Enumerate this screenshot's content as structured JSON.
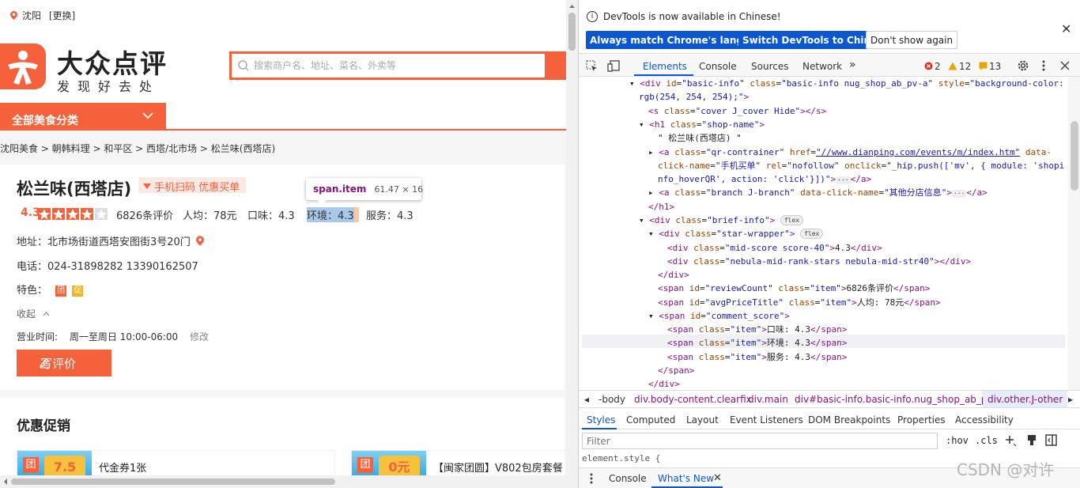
{
  "page": {
    "city": "沈阳",
    "switch_city": "[更换]",
    "logo_main": "大众点评",
    "logo_sub": "发现好去处",
    "search_placeholder": "搜索商户名、地址、菜名、外卖等",
    "category_button": "全部美食分类",
    "breadcrumb": "沈阳美食 > 朝韩料理 > 和平区 > 西塔/北市场 > 松兰味(西塔店)",
    "shop_name": "松兰味(西塔店)",
    "qr_label": "手机扫码 优惠买单",
    "tooltip_name": "span.item",
    "tooltip_size": "61.47 × 16",
    "score": "4.3",
    "star_rating": 4,
    "star_max": 5,
    "review_count": "6826条评价",
    "avg_price": "人均：78元",
    "taste": "口味：4.3",
    "environment": "环境：4.3",
    "service": "服务：4.3",
    "address": "地址：北市场街道西塔安图街3号20门",
    "phone": "电话：024-31898282 13390162507",
    "features_label": "特色：",
    "feature_tags": [
      "团",
      "促"
    ],
    "collapse": "收起",
    "hours_label": "营业时间:",
    "hours_value": "周一至周日 10:00-06:00",
    "hours_edit": "修改",
    "review_button": "写评价",
    "promo_title": "优惠促销",
    "promos": [
      {
        "badge": "团",
        "image_text": "7.5",
        "title": "代金券1张"
      },
      {
        "badge": "团",
        "image_text": "0元",
        "title": "【闽家团圆】V802包房套餐"
      }
    ]
  },
  "devtools": {
    "notice": "DevTools is now available in Chinese!",
    "btn_match": "Always match Chrome's language",
    "btn_switch": "Switch DevTools to Chinese",
    "btn_dont_show": "Don't show again",
    "tabs": [
      "Elements",
      "Console",
      "Sources",
      "Network"
    ],
    "errors": "2",
    "warnings": "12",
    "issues": "13",
    "breadcrumbs": [
      "-body",
      "div.body-content.clearfix",
      "div.main",
      "div#basic-info.basic-info.nug_shop_ab_pv-a",
      "div.other.J-other"
    ],
    "style_tabs": [
      "Styles",
      "Computed",
      "Layout",
      "Event Listeners",
      "DOM Breakpoints",
      "Properties",
      "Accessibility"
    ],
    "filter_placeholder": "Filter",
    "hov": ":hov",
    "cls": ".cls",
    "element_style": "element.style {",
    "drawer_tabs": [
      "Console",
      "What's New"
    ],
    "watermark": "CSDN @对许"
  },
  "colors": {
    "brand": "#f5613a",
    "devtools_blue": "#0b57d0"
  }
}
